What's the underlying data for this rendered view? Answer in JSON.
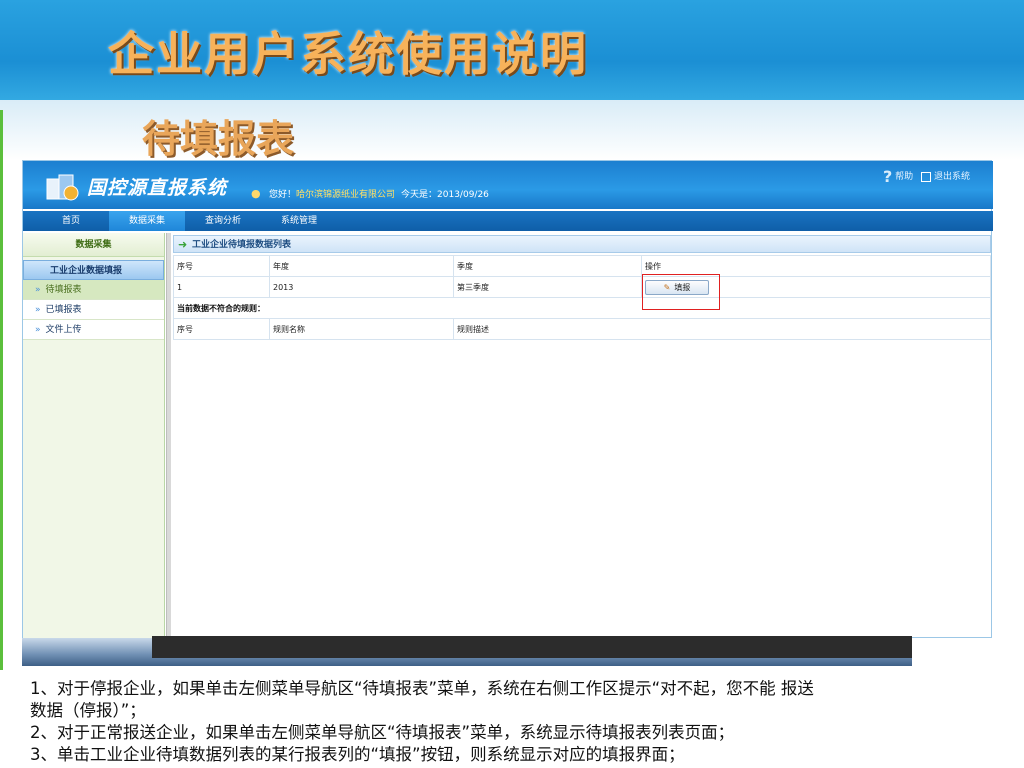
{
  "slide": {
    "title": "企业用户系统使用说明",
    "subtitle": "待填报表"
  },
  "app": {
    "name": "国控源直报系统",
    "greeting_prefix": "您好！",
    "company": "哈尔滨锦源纸业有限公司",
    "date_text": "今天是：2013/09/26",
    "help_label": "帮助",
    "exit_label": "退出系统"
  },
  "nav": {
    "tabs": [
      {
        "label": "首页"
      },
      {
        "label": "数据采集"
      },
      {
        "label": "查询分析"
      },
      {
        "label": "系统管理"
      }
    ]
  },
  "sidebar": {
    "title": "数据采集",
    "group": "工业企业数据填报",
    "items": [
      {
        "label": "待填报表"
      },
      {
        "label": "已填报表"
      },
      {
        "label": "文件上传"
      }
    ]
  },
  "main": {
    "panel_title": "工业企业待填报数据列表",
    "columns": [
      "序号",
      "年度",
      "季度",
      "操作"
    ],
    "rows": [
      {
        "index": "1",
        "year": "2013",
        "quarter": "第三季度",
        "action": "填报"
      }
    ],
    "rules_title": "当前数据不符合的规则：",
    "rules_columns": [
      "序号",
      "规则名称",
      "规则描述"
    ]
  },
  "notes": {
    "line1": "1、对于停报企业，如果单击左侧菜单导航区“待填报表”菜单，系统在右侧工作区提示“对不起，您不能 报送",
    "line2": "数据（停报）”；",
    "line3": "2、对于正常报送企业，如果单击左侧菜单导航区“待填报表”菜单，系统显示待填报表列表页面；",
    "line4": "3、单击工业企业待填数据列表的某行报表列的“填报”按钮，则系统显示对应的填报界面；"
  },
  "colors": {
    "header_blue": "#1b8fd4",
    "title_orange": "#f7b25a",
    "highlight_red": "#e02020"
  }
}
